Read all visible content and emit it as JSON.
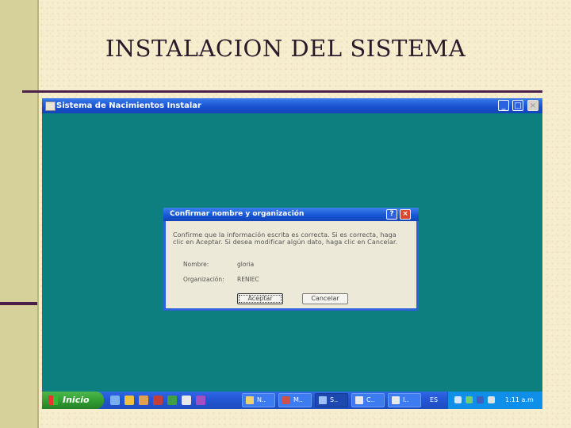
{
  "slide": {
    "title": "INSTALACION DEL SISTEMA"
  },
  "window": {
    "title": "Sistema de Nacimientos Instalar",
    "controls": {
      "minimize": "_",
      "maximize": "□",
      "close": "×"
    }
  },
  "dialog": {
    "title": "Confirmar nombre y organización",
    "help_label": "?",
    "close_label": "×",
    "message": "Confirme que la información escrita es correcta. Si es correcta, haga clic en Aceptar. Si desea modificar algún dato, haga clic en Cancelar.",
    "fields": [
      {
        "label": "Nombre:",
        "value": "gloria"
      },
      {
        "label": "Organización:",
        "value": "RENIEC"
      }
    ],
    "ok_label": "Aceptar",
    "cancel_label": "Cancelar"
  },
  "taskbar": {
    "start_label": "Inicio",
    "tasks": [
      {
        "label": "N..",
        "icon": "folder-icon"
      },
      {
        "label": "M..",
        "icon": "app-icon"
      },
      {
        "label": "S..",
        "icon": "setup-icon"
      },
      {
        "label": "C..",
        "icon": "window-icon"
      },
      {
        "label": "I..",
        "icon": "window-icon"
      }
    ],
    "language": "ES",
    "clock": "1:11 a.m"
  },
  "colors": {
    "desktop": "#0e7f7f",
    "titlebar": "#1750cf",
    "taskbar": "#2458d6",
    "start": "#2f9a2f"
  }
}
